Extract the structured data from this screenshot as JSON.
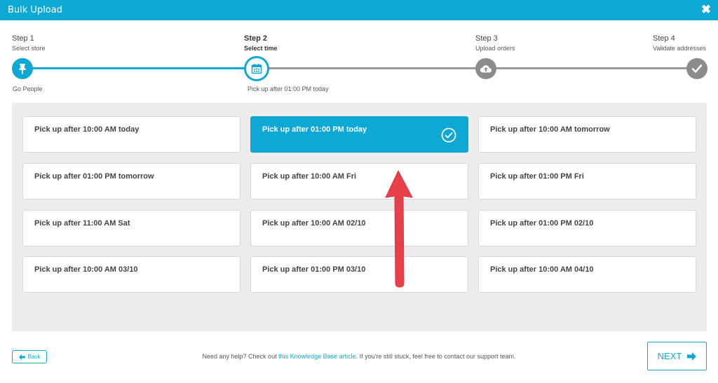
{
  "window": {
    "title": "Bulk Upload",
    "close_icon": "close-icon"
  },
  "steps": [
    {
      "number": "Step 1",
      "subtitle": "Select store",
      "detail": "Go People",
      "icon": "pin-icon",
      "state": "done"
    },
    {
      "number": "Step 2",
      "subtitle": "Select time",
      "detail": "Pick up after 01:00 PM today",
      "icon": "calendar-icon",
      "state": "current"
    },
    {
      "number": "Step 3",
      "subtitle": "Upload orders",
      "detail": "",
      "icon": "cloud-upload-icon",
      "state": "todo"
    },
    {
      "number": "Step 4",
      "subtitle": "Validate addresses",
      "detail": "",
      "icon": "checkmark-icon",
      "state": "todo"
    }
  ],
  "options": [
    {
      "label": "Pick up after 10:00 AM today",
      "selected": false
    },
    {
      "label": "Pick up after 01:00 PM today",
      "selected": true
    },
    {
      "label": "Pick up after 10:00 AM tomorrow",
      "selected": false
    },
    {
      "label": "Pick up after 01:00 PM tomorrow",
      "selected": false
    },
    {
      "label": "Pick up after 10:00 AM Fri",
      "selected": false
    },
    {
      "label": "Pick up after 01:00 PM Fri",
      "selected": false
    },
    {
      "label": "Pick up after 11:00 AM Sat",
      "selected": false
    },
    {
      "label": "Pick up after 10:00 AM 02/10",
      "selected": false
    },
    {
      "label": "Pick up after 01:00 PM 02/10",
      "selected": false
    },
    {
      "label": "Pick up after 10:00 AM 03/10",
      "selected": false
    },
    {
      "label": "Pick up after 01:00 PM 03/10",
      "selected": false
    },
    {
      "label": "Pick up after 10:00 AM 04/10",
      "selected": false
    }
  ],
  "footer": {
    "back_label": "Back",
    "help_prefix": "Need any help? Check out",
    "help_link": "this Knowledge Base article",
    "help_suffix": ". If you're still stuck, feel free to contact our support team.",
    "next_label": "NEXT"
  },
  "colors": {
    "accent": "#0ea8d4",
    "inactive": "#8c8c8c",
    "annotation_arrow": "#e8404a"
  }
}
